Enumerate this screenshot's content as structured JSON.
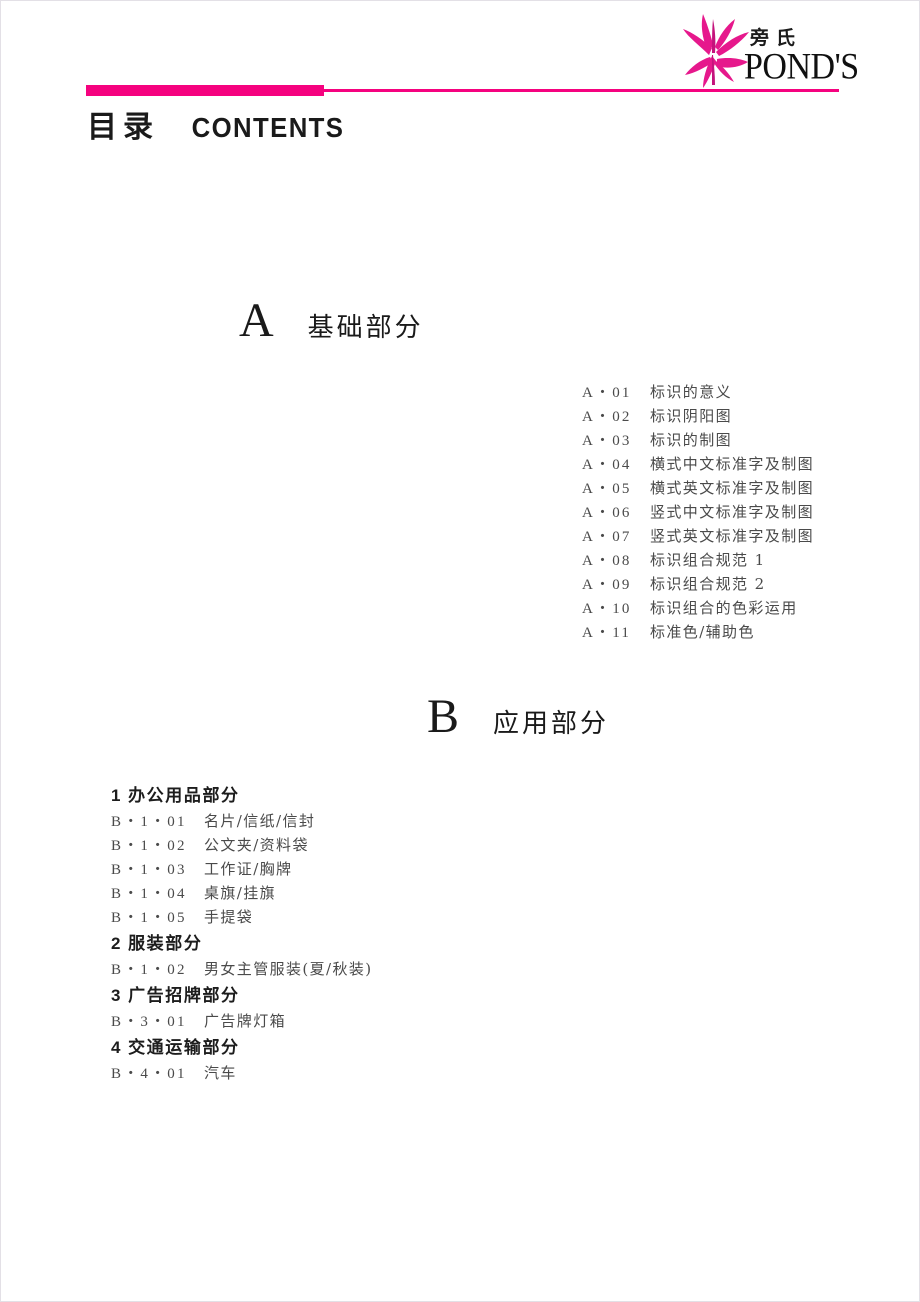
{
  "brand": {
    "logo_icon": "butterfly-icon",
    "name_cn": "旁氏",
    "name_en": "POND'S",
    "accent_color": "#f5027f"
  },
  "header": {
    "title_cn": "目录",
    "title_en": "CONTENTS"
  },
  "sections": [
    {
      "letter": "A",
      "name": "基础部分",
      "entries": [
        {
          "code": "A・01",
          "label": "标识的意义"
        },
        {
          "code": "A・02",
          "label": "标识阴阳图"
        },
        {
          "code": "A・03",
          "label": "标识的制图"
        },
        {
          "code": "A・04",
          "label": "横式中文标准字及制图"
        },
        {
          "code": "A・05",
          "label": "横式英文标准字及制图"
        },
        {
          "code": "A・06",
          "label": "竖式中文标准字及制图"
        },
        {
          "code": "A・07",
          "label": "竖式英文标准字及制图"
        },
        {
          "code": "A・08",
          "label": "标识组合规范 1"
        },
        {
          "code": "A・09",
          "label": "标识组合规范 2"
        },
        {
          "code": "A・10",
          "label": "标识组合的色彩运用"
        },
        {
          "code": "A・11",
          "label": "标准色/辅助色"
        }
      ]
    },
    {
      "letter": "B",
      "name": "应用部分",
      "groups": [
        {
          "num": "1",
          "name": "办公用品部分",
          "entries": [
            {
              "code": "B・1・01",
              "label": "名片/信纸/信封"
            },
            {
              "code": "B・1・02",
              "label": "公文夹/资料袋"
            },
            {
              "code": "B・1・03",
              "label": "工作证/胸牌"
            },
            {
              "code": "B・1・04",
              "label": "桌旗/挂旗"
            },
            {
              "code": "B・1・05",
              "label": "手提袋"
            }
          ]
        },
        {
          "num": "2",
          "name": "服装部分",
          "entries": [
            {
              "code": "B・1・02",
              "label": "男女主管服装(夏/秋装)"
            }
          ]
        },
        {
          "num": "3",
          "name": "广告招牌部分",
          "entries": [
            {
              "code": "B・3・01",
              "label": "广告牌灯箱"
            }
          ]
        },
        {
          "num": "4",
          "name": "交通运输部分",
          "entries": [
            {
              "code": "B・4・01",
              "label": "汽车"
            }
          ]
        }
      ]
    }
  ]
}
